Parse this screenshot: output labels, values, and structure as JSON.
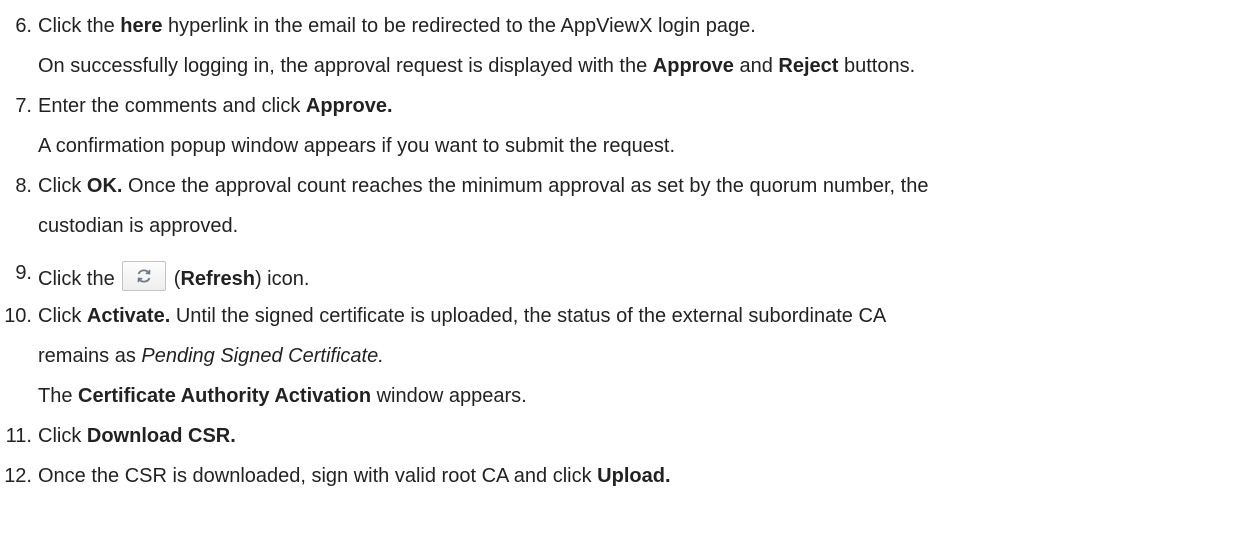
{
  "steps": [
    {
      "number": "6.",
      "line1": {
        "pre": "Click the ",
        "bold": "here",
        "post": " hyperlink in the email to be redirected to the AppViewX login page."
      },
      "line2": {
        "pre": "On successfully logging in, the approval request is displayed with the ",
        "bold1": "Approve",
        "mid": " and ",
        "bold2": "Reject",
        "post": " buttons."
      }
    },
    {
      "number": "7.",
      "line1": {
        "pre": "Enter the comments and click ",
        "bold": "Approve."
      },
      "line2": {
        "text": "A confirmation popup window appears if you want to submit the request."
      }
    },
    {
      "number": "8.",
      "line1": {
        "pre": "Click ",
        "bold": "OK.",
        "post": " Once the approval count reaches the minimum approval as set by the quorum number, the"
      },
      "line2": {
        "text": "custodian is approved."
      }
    },
    {
      "number": "9.",
      "line1": {
        "pre": "Click the ",
        "icon": "refresh-icon",
        "open": " (",
        "bold": "Refresh",
        "post": ") icon."
      }
    },
    {
      "number": "10.",
      "line1": {
        "pre": "Click ",
        "bold": "Activate.",
        "post": " Until the signed certificate is uploaded, the status of the external subordinate CA"
      },
      "line2": {
        "pre": "remains as ",
        "italic": "Pending Signed Certificate."
      },
      "line3": {
        "pre": "The ",
        "bold": "Certificate Authority Activation",
        "post": " window appears."
      }
    },
    {
      "number": "11.",
      "line1": {
        "pre": "Click ",
        "bold": "Download CSR."
      }
    },
    {
      "number": "12.",
      "line1": {
        "pre": "Once the CSR is downloaded, sign with valid root CA and click ",
        "bold": "Upload."
      }
    }
  ],
  "colors": {
    "text": "#222222",
    "icon": "#6b7a8a"
  }
}
